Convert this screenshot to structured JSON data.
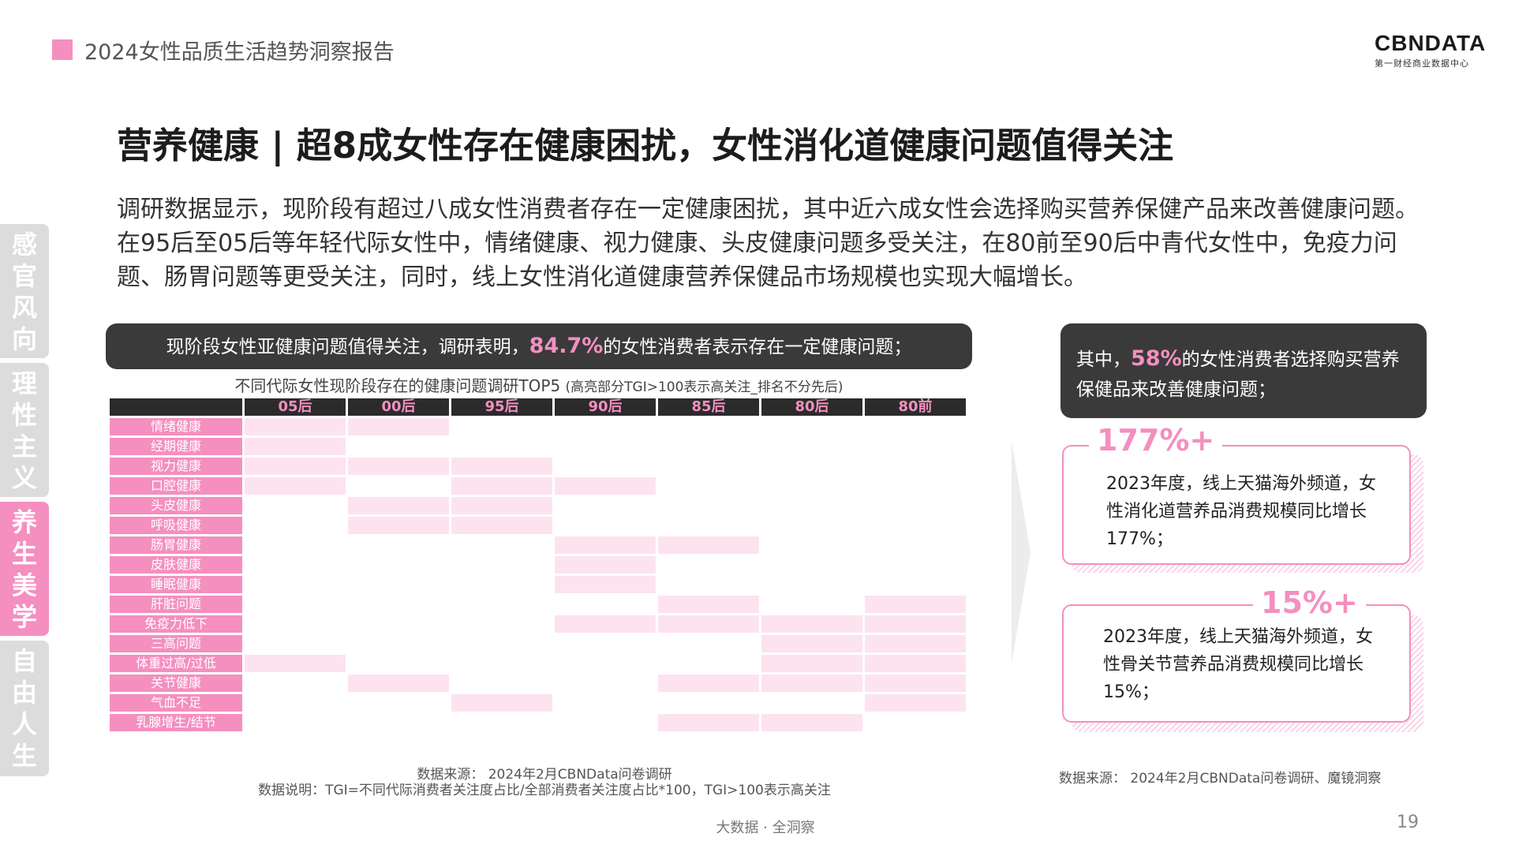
{
  "header": {
    "title": "2024女性品质生活趋势洞察报告",
    "logo_main": "CBNDATA",
    "logo_sub": "第一财经商业数据中心"
  },
  "main_title": "营养健康 | 超8成女性存在健康困扰，女性消化道健康问题值得关注",
  "intro": "调研数据显示，现阶段有超过八成女性消费者存在一定健康困扰，其中近六成女性会选择购买营养保健产品来改善健康问题。在95后至05后等年轻代际女性中，情绪健康、视力健康、头皮健康问题多受关注，在80前至90后中青代女性中，免疫力问题、肠胃问题等更受关注，同时，线上女性消化道健康营养保健品市场规模也实现大幅增长。",
  "side_tabs": [
    {
      "label": "感官风向",
      "active": false
    },
    {
      "label": "理性主义",
      "active": false
    },
    {
      "label": "养生美学",
      "active": true
    },
    {
      "label": "自由人生",
      "active": false
    }
  ],
  "left_callout": {
    "prefix": "现阶段女性亚健康问题值得关注，调研表明，",
    "value": "84.7%",
    "suffix": "的女性消费者表示存在一定健康问题；"
  },
  "table": {
    "caption": "不同代际女性现阶段存在的健康问题调研TOP5",
    "caption_note": "(高亮部分TGI>100表示高关注_排名不分先后)",
    "columns": [
      "05后",
      "00后",
      "95后",
      "90后",
      "85后",
      "80后",
      "80前"
    ],
    "highlight_color": "#fde3ef",
    "label_color": "#f48fc0",
    "rows": [
      {
        "label": "情绪健康",
        "highlight": [
          1,
          1,
          0,
          0,
          0,
          0,
          0
        ]
      },
      {
        "label": "经期健康",
        "highlight": [
          1,
          0,
          0,
          0,
          0,
          0,
          0
        ]
      },
      {
        "label": "视力健康",
        "highlight": [
          1,
          1,
          1,
          0,
          0,
          0,
          0
        ]
      },
      {
        "label": "口腔健康",
        "highlight": [
          1,
          0,
          1,
          1,
          0,
          0,
          0
        ]
      },
      {
        "label": "头皮健康",
        "highlight": [
          0,
          1,
          1,
          0,
          0,
          0,
          0
        ]
      },
      {
        "label": "呼吸健康",
        "highlight": [
          0,
          1,
          1,
          0,
          0,
          0,
          0
        ]
      },
      {
        "label": "肠胃健康",
        "highlight": [
          0,
          0,
          0,
          1,
          1,
          0,
          0
        ]
      },
      {
        "label": "皮肤健康",
        "highlight": [
          0,
          0,
          0,
          1,
          0,
          0,
          0
        ]
      },
      {
        "label": "睡眠健康",
        "highlight": [
          0,
          0,
          0,
          1,
          0,
          0,
          0
        ]
      },
      {
        "label": "肝脏问题",
        "highlight": [
          0,
          0,
          0,
          0,
          1,
          0,
          1
        ]
      },
      {
        "label": "免疫力低下",
        "highlight": [
          0,
          0,
          0,
          1,
          1,
          1,
          1
        ]
      },
      {
        "label": "三高问题",
        "highlight": [
          0,
          0,
          0,
          0,
          0,
          1,
          1
        ]
      },
      {
        "label": "体重过高/过低",
        "highlight": [
          1,
          0,
          0,
          0,
          0,
          1,
          1
        ]
      },
      {
        "label": "关节健康",
        "highlight": [
          0,
          1,
          0,
          0,
          1,
          1,
          1
        ]
      },
      {
        "label": "气血不足",
        "highlight": [
          0,
          0,
          1,
          0,
          0,
          0,
          1
        ]
      },
      {
        "label": "乳腺增生/结节",
        "highlight": [
          0,
          0,
          0,
          0,
          1,
          1,
          0
        ]
      }
    ]
  },
  "left_source": {
    "line1": "数据来源： 2024年2月CBNData问卷调研",
    "line2": "数据说明：TGI=不同代际消费者关注度占比/全部消费者关注度占比*100，TGI>100表示高关注"
  },
  "right_callout": {
    "prefix": "其中，",
    "value": "58%",
    "suffix": "的女性消费者选择购买营养保健品来改善健康问题；"
  },
  "stat_cards": [
    {
      "value": "177%+",
      "text": "2023年度，线上天猫海外频道，女性消化道营养品消费规模同比增长177%；"
    },
    {
      "value": "15%+",
      "text": "2023年度，线上天猫海外频道，女性骨关节营养品消费规模同比增长15%；"
    }
  ],
  "right_source": "数据来源： 2024年2月CBNData问卷调研、魔镜洞察",
  "footer": {
    "center": "大数据 · 全洞察",
    "page": "19"
  }
}
